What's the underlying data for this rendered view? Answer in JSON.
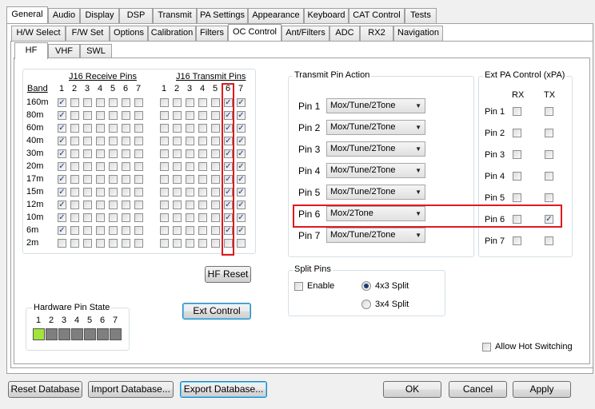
{
  "main_tabs": [
    {
      "label": "General"
    },
    {
      "label": "Audio"
    },
    {
      "label": "Display"
    },
    {
      "label": "DSP"
    },
    {
      "label": "Transmit"
    },
    {
      "label": "PA Settings"
    },
    {
      "label": "Appearance"
    },
    {
      "label": "Keyboard"
    },
    {
      "label": "CAT Control"
    },
    {
      "label": "Tests"
    }
  ],
  "sub_tabs": [
    {
      "label": "H/W Select"
    },
    {
      "label": "F/W Set"
    },
    {
      "label": "Options"
    },
    {
      "label": "Calibration"
    },
    {
      "label": "Filters"
    },
    {
      "label": "OC Control"
    },
    {
      "label": "Ant/Filters"
    },
    {
      "label": "ADC"
    },
    {
      "label": "RX2"
    },
    {
      "label": "Navigation"
    }
  ],
  "band_tabs": [
    {
      "label": "HF"
    },
    {
      "label": "VHF"
    },
    {
      "label": "SWL"
    }
  ],
  "j16": {
    "receive_title": "J16 Receive Pins",
    "transmit_title": "J16 Transmit Pins",
    "band_header": "Band",
    "pin_numbers": [
      "1",
      "2",
      "3",
      "4",
      "5",
      "6",
      "7"
    ],
    "bands": [
      {
        "name": "160m",
        "rx": [
          1,
          0,
          0,
          0,
          0,
          0,
          0
        ],
        "tx": [
          0,
          0,
          0,
          0,
          0,
          1,
          1
        ]
      },
      {
        "name": "80m",
        "rx": [
          1,
          0,
          0,
          0,
          0,
          0,
          0
        ],
        "tx": [
          0,
          0,
          0,
          0,
          0,
          1,
          1
        ]
      },
      {
        "name": "60m",
        "rx": [
          1,
          0,
          0,
          0,
          0,
          0,
          0
        ],
        "tx": [
          0,
          0,
          0,
          0,
          0,
          1,
          1
        ]
      },
      {
        "name": "40m",
        "rx": [
          1,
          0,
          0,
          0,
          0,
          0,
          0
        ],
        "tx": [
          0,
          0,
          0,
          0,
          0,
          1,
          1
        ]
      },
      {
        "name": "30m",
        "rx": [
          1,
          0,
          0,
          0,
          0,
          0,
          0
        ],
        "tx": [
          0,
          0,
          0,
          0,
          0,
          1,
          1
        ]
      },
      {
        "name": "20m",
        "rx": [
          1,
          0,
          0,
          0,
          0,
          0,
          0
        ],
        "tx": [
          0,
          0,
          0,
          0,
          0,
          1,
          1
        ]
      },
      {
        "name": "17m",
        "rx": [
          1,
          0,
          0,
          0,
          0,
          0,
          0
        ],
        "tx": [
          0,
          0,
          0,
          0,
          0,
          1,
          1
        ]
      },
      {
        "name": "15m",
        "rx": [
          1,
          0,
          0,
          0,
          0,
          0,
          0
        ],
        "tx": [
          0,
          0,
          0,
          0,
          0,
          1,
          1
        ]
      },
      {
        "name": "12m",
        "rx": [
          1,
          0,
          0,
          0,
          0,
          0,
          0
        ],
        "tx": [
          0,
          0,
          0,
          0,
          0,
          1,
          1
        ]
      },
      {
        "name": "10m",
        "rx": [
          1,
          0,
          0,
          0,
          0,
          0,
          0
        ],
        "tx": [
          0,
          0,
          0,
          0,
          0,
          1,
          1
        ]
      },
      {
        "name": "6m",
        "rx": [
          1,
          0,
          0,
          0,
          0,
          0,
          0
        ],
        "tx": [
          0,
          0,
          0,
          0,
          0,
          1,
          1
        ]
      },
      {
        "name": "2m",
        "rx": [
          0,
          0,
          0,
          0,
          0,
          0,
          0
        ],
        "tx": [
          0,
          0,
          0,
          0,
          0,
          0,
          0
        ]
      }
    ]
  },
  "hf_reset_label": "HF Reset",
  "ext_control_label": "Ext Control",
  "hardware_pin_state": {
    "title": "Hardware Pin State",
    "pin_numbers": [
      "1",
      "2",
      "3",
      "4",
      "5",
      "6",
      "7"
    ],
    "states": [
      1,
      0,
      0,
      0,
      0,
      0,
      0
    ],
    "on_color": "#a1e43a",
    "off_color": "#7f7f7f"
  },
  "transmit_pin_action": {
    "title": "Transmit Pin Action",
    "pins": [
      {
        "label": "Pin 1",
        "value": "Mox/Tune/2Tone"
      },
      {
        "label": "Pin 2",
        "value": "Mox/Tune/2Tone"
      },
      {
        "label": "Pin 3",
        "value": "Mox/Tune/2Tone"
      },
      {
        "label": "Pin 4",
        "value": "Mox/Tune/2Tone"
      },
      {
        "label": "Pin 5",
        "value": "Mox/Tune/2Tone"
      },
      {
        "label": "Pin 6",
        "value": "Mox/2Tone"
      },
      {
        "label": "Pin 7",
        "value": "Mox/Tune/2Tone"
      }
    ]
  },
  "ext_pa": {
    "title": "Ext PA Control (xPA)",
    "rx_label": "RX",
    "tx_label": "TX",
    "pins": [
      {
        "label": "Pin 1",
        "rx": 0,
        "tx": 0
      },
      {
        "label": "Pin 2",
        "rx": 0,
        "tx": 0
      },
      {
        "label": "Pin 3",
        "rx": 0,
        "tx": 0
      },
      {
        "label": "Pin 4",
        "rx": 0,
        "tx": 0
      },
      {
        "label": "Pin 5",
        "rx": 0,
        "tx": 0
      },
      {
        "label": "Pin 6",
        "rx": 0,
        "tx": 1
      },
      {
        "label": "Pin 7",
        "rx": 0,
        "tx": 0
      }
    ]
  },
  "split_pins": {
    "title": "Split Pins",
    "enable_label": "Enable",
    "enable_checked": false,
    "option_4x3": "4x3 Split",
    "option_3x4": "3x4 Split",
    "selected": "4x3 Split"
  },
  "allow_hot_switching_label": "Allow Hot Switching",
  "bottom_buttons": {
    "reset_db": "Reset Database",
    "import_db": "Import Database...",
    "export_db": "Export Database...",
    "ok": "OK",
    "cancel": "Cancel",
    "apply": "Apply"
  },
  "highlight_color": "#e0191e",
  "check_mark": "✓"
}
